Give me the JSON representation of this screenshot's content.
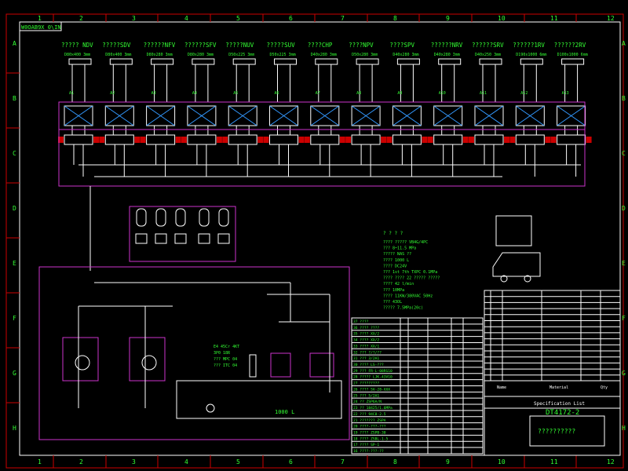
{
  "drawing": {
    "corner_label": "W0OAB9X 0\\IN",
    "columns": [
      "1",
      "2",
      "3",
      "4",
      "5",
      "6",
      "7",
      "8",
      "9",
      "10",
      "11",
      "12"
    ],
    "rows": [
      "A",
      "B",
      "C",
      "D",
      "E",
      "F",
      "G",
      "H"
    ],
    "cylinders": [
      {
        "label": "????? NDV",
        "size": "D80x400 3mm",
        "tag": "A1"
      },
      {
        "label": "?????SDV",
        "size": "D80x400 3mm",
        "tag": "A2"
      },
      {
        "label": "??????NFV",
        "size": "D80x280 3mm",
        "tag": "A3"
      },
      {
        "label": "??????SFV",
        "size": "D80x280 3mm",
        "tag": "A4"
      },
      {
        "label": "?????NUV",
        "size": "D50x225 3mm",
        "tag": "A5"
      },
      {
        "label": "?????SUV",
        "size": "D50x225 3mm",
        "tag": "A6"
      },
      {
        "label": "????CHP",
        "size": "D40x280 3mm",
        "tag": "A7"
      },
      {
        "label": "????NPV",
        "size": "D50x280 3mm",
        "tag": "A8"
      },
      {
        "label": "????SPV",
        "size": "D40x280 3mm",
        "tag": "A9"
      },
      {
        "label": "??????NRV",
        "size": "D40x280 3mm",
        "tag": "A10"
      },
      {
        "label": "??????SRV",
        "size": "D40x250 3mm",
        "tag": "A11"
      },
      {
        "label": "??????1RV",
        "size": "D190x1000 6mm",
        "tag": "A12"
      },
      {
        "label": "??????2RV",
        "size": "D100x1000 6mm",
        "tag": "A13"
      }
    ],
    "notes": {
      "heading": "? ? ? ?",
      "lines": [
        "???? ????? VB4G/4PC",
        "???  8~11.5 MPa",
        "????? NAS ??",
        "????  1000 L",
        "????  DC24V",
        "???   1st 7th TXPC 0.1MPa",
        "????  ???? 22 ????? ?????",
        "      ???? 42 l/min",
        "      ???  10MPa",
        "      ???? 11KW/380VAC 50Hz",
        "??? 43OL",
        "    ????? 7.5MPa(20c)"
      ]
    },
    "power_unit": {
      "tank_volume": "1000 L",
      "motor_spec": [
        "E4 45Cr 4KT",
        "3P0 18R",
        "??? MPC 04",
        "??? ITC 04"
      ]
    },
    "spec_table_rows": [
      "37 ????",
      "36 ???? ????",
      "35 ???? XX/2",
      "34 ???? XX/2",
      "33 ???? XX/1",
      "32 ??? ?/?/??",
      "31 ??? 3/2A1",
      "30 ???? LS-???",
      "29 ??? FR-L-08RS10",
      "28 ????? LJK-43V10",
      "27 ?????????",
      "26 ???? SV-28-XXX",
      "25 ??? 5/2A1",
      "24 ?? ZSP6A/N",
      "23 ?? 18425/1.6MPa",
      "22 ??? 94C8-2.5",
      "21 ??????? ZSPA",
      "20 ????-???-???",
      "19 ???? ZSPB-30",
      "18 ???? ZSBL-1-5",
      "17 ???? SP-1",
      "16 ????-???-??"
    ],
    "title_block": {
      "spec_label": "Specification List",
      "drawing_number": "DT4172-2",
      "drawing_title": "??????????",
      "name_header": "Name",
      "material_header": "Material",
      "qty_header": "Qty"
    },
    "colors": {
      "background": "#000000",
      "frame": "#ffffff",
      "grid_ticks": "#cc0000",
      "text": "#33ff33",
      "groups": "#cc33cc",
      "lines": "#ffffff"
    }
  }
}
